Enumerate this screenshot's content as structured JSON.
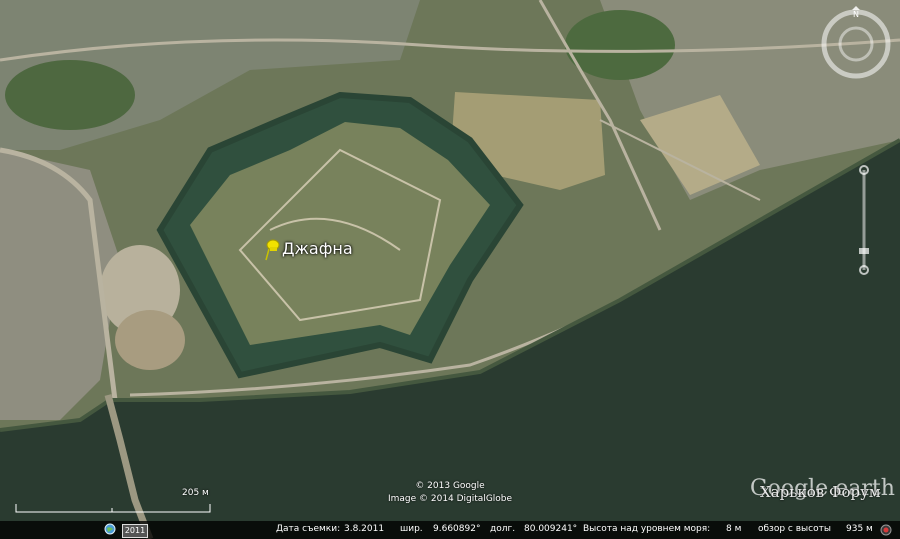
{
  "placemark": {
    "label": "Джафна",
    "icon": "yellow-pushpin-icon"
  },
  "scale": {
    "label": "205 м"
  },
  "credits": {
    "line1": "© 2013 Google",
    "line2": "Image © 2014 DigitalGlobe"
  },
  "brand": {
    "text": "Google earth"
  },
  "watermark": {
    "text": "Харьков Форум"
  },
  "status": {
    "year": "2011",
    "date_label": "Дата съемки:",
    "date_value": "3.8.2011",
    "lat_label": "шир.",
    "lat_value": "9.660892°",
    "lon_label": "долг.",
    "lon_value": "80.009241°",
    "elev_label": "Высота над уровнем моря:",
    "elev_value": "8 м",
    "eye_label": "обзор с высоты",
    "eye_value": "935 м"
  },
  "colors": {
    "water": "#2a3b30",
    "land": "#6f7a58",
    "moat": "#2e4a3a",
    "road": "#b9b3a0",
    "pin": "#f2e100"
  },
  "icons": [
    "compass-icon",
    "zoom-slider-icon",
    "globe-icon",
    "record-icon",
    "yellow-pushpin-icon"
  ]
}
